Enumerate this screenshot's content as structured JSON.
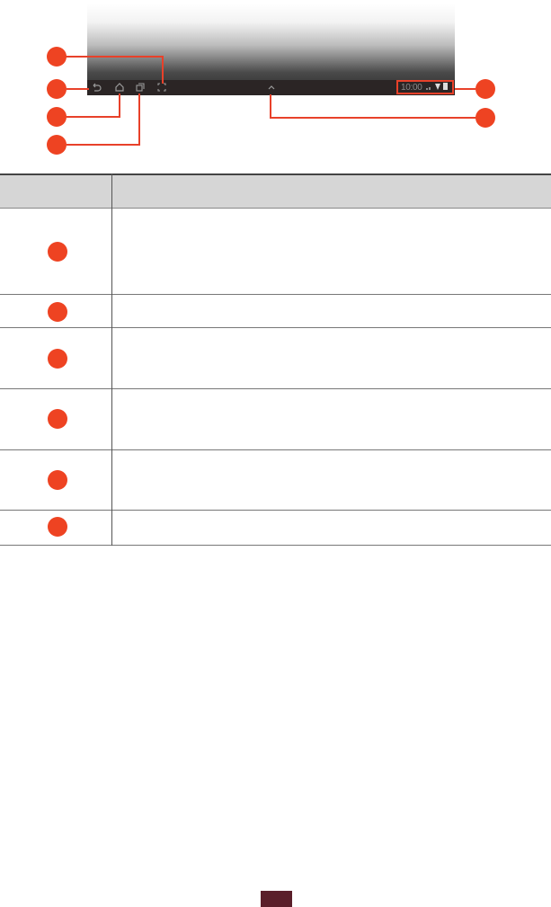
{
  "status_bar": {
    "clock": "10:00"
  },
  "table": {
    "header": [
      "",
      ""
    ],
    "rows": [
      {
        "marker": "",
        "description": ""
      },
      {
        "marker": "",
        "description": ""
      },
      {
        "marker": "",
        "description": ""
      },
      {
        "marker": "",
        "description": ""
      },
      {
        "marker": "",
        "description": ""
      },
      {
        "marker": "",
        "description": ""
      }
    ]
  },
  "page": {
    "number": ""
  },
  "colors": {
    "callout": "#ee4322",
    "navbar": "#2b2525",
    "page_tab": "#5a1f2a"
  }
}
